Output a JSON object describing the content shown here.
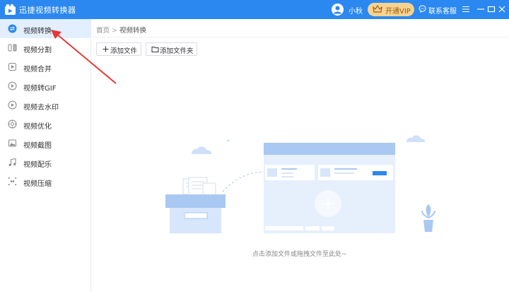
{
  "window": {
    "title": "迅捷视频转换器",
    "username": "小秋",
    "vip_label": "开通VIP",
    "customer_service_label": "联系客服"
  },
  "sidebar": {
    "items": [
      {
        "label": "视频转换",
        "icon": "convert-icon",
        "active": true
      },
      {
        "label": "视频分割",
        "icon": "split-icon",
        "active": false
      },
      {
        "label": "视频合并",
        "icon": "merge-icon",
        "active": false
      },
      {
        "label": "视频转GIF",
        "icon": "gif-icon",
        "active": false
      },
      {
        "label": "视频去水印",
        "icon": "watermark-icon",
        "active": false
      },
      {
        "label": "视频优化",
        "icon": "optimize-icon",
        "active": false
      },
      {
        "label": "视频截图",
        "icon": "screenshot-icon",
        "active": false
      },
      {
        "label": "视频配乐",
        "icon": "music-icon",
        "active": false
      },
      {
        "label": "视频压缩",
        "icon": "compress-icon",
        "active": false
      }
    ]
  },
  "breadcrumb": {
    "home": "首页",
    "separator": ">",
    "current": "视频转换"
  },
  "toolbar": {
    "add_file_label": "添加文件",
    "add_folder_label": "添加文件夹"
  },
  "empty_state": {
    "hint": "点击添加文件或拖拽文件至此处~"
  },
  "colors": {
    "titlebar": "#2b88f0",
    "sidebar_active": "#e3efff",
    "vip": "#f8d28e",
    "annotation_arrow": "#e53935"
  }
}
